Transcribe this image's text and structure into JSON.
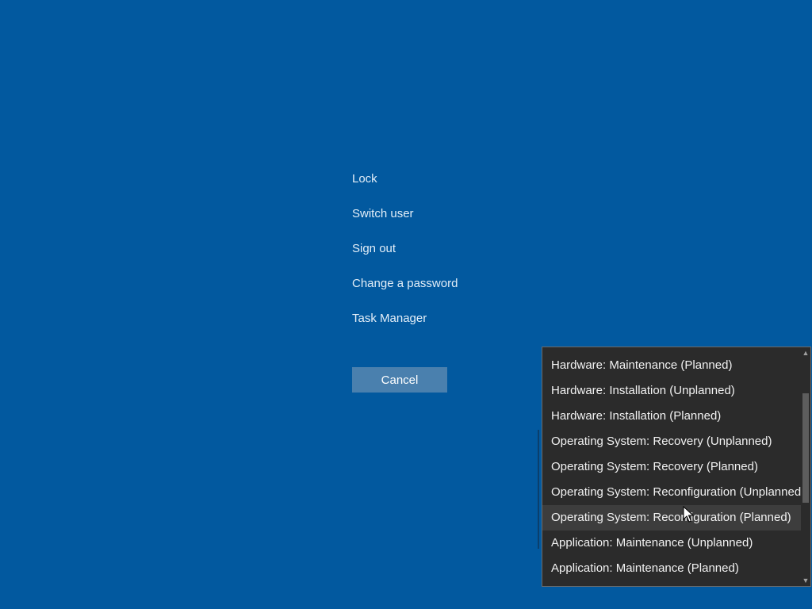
{
  "security_options": {
    "items": [
      {
        "label": "Lock"
      },
      {
        "label": "Switch user"
      },
      {
        "label": "Sign out"
      },
      {
        "label": "Change a password"
      },
      {
        "label": "Task Manager"
      }
    ],
    "cancel_label": "Cancel"
  },
  "dropdown": {
    "items": [
      {
        "label": "Hardware: Maintenance (Planned)"
      },
      {
        "label": "Hardware: Installation (Unplanned)"
      },
      {
        "label": "Hardware: Installation (Planned)"
      },
      {
        "label": "Operating System: Recovery (Unplanned)"
      },
      {
        "label": "Operating System: Recovery (Planned)"
      },
      {
        "label": "Operating System: Reconfiguration (Unplanned)"
      },
      {
        "label": "Operating System: Reconfiguration (Planned)"
      },
      {
        "label": "Application: Maintenance (Unplanned)"
      },
      {
        "label": "Application: Maintenance (Planned)"
      }
    ],
    "hovered_item": "Operating System: Reconfiguration (Planned)",
    "scroll_up_icon": "chevron-up-icon",
    "scroll_down_icon": "chevron-down-icon"
  },
  "colors": {
    "background": "#02599f",
    "button": "#4a80ae",
    "dropdown_bg": "#2b2b2b",
    "dropdown_hover": "#3d3d3d",
    "scroll_thumb": "#5d5d5d"
  }
}
